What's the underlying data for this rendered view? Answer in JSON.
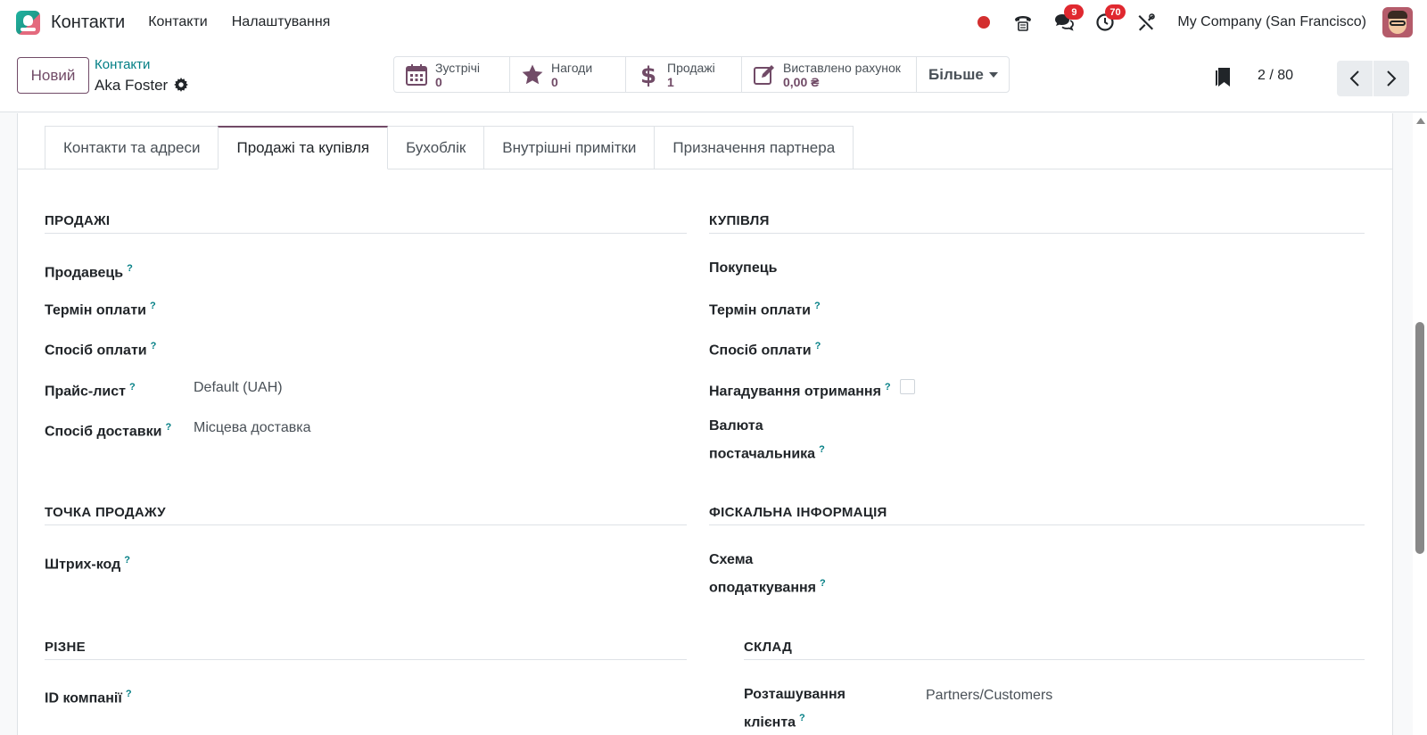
{
  "topnav": {
    "app_name": "Контакти",
    "menu": [
      "Контакти",
      "Налаштування"
    ],
    "messages_badge": "9",
    "activities_badge": "70",
    "company": "My Company (San Francisco)",
    "icons": {
      "logo": "contacts-app-icon",
      "record": "red-record-dot",
      "phone": "phone-icon",
      "messages": "chat-bubbles-icon",
      "activities": "clock-icon",
      "debug": "tools-icon"
    },
    "colors": {
      "accent": "#714b67",
      "link": "#017e84",
      "badge": "#e0282f"
    }
  },
  "control": {
    "new_button": "Новий",
    "breadcrumb": "Контакти",
    "record_name": "Aka Foster",
    "smart_buttons": [
      {
        "label": "Зустрічі",
        "value": "0",
        "icon": "calendar-icon"
      },
      {
        "label": "Нагоди",
        "value": "0",
        "icon": "star-icon"
      },
      {
        "label": "Продажі",
        "value": "1",
        "icon": "dollar-icon"
      },
      {
        "label": "Виставлено рахунок",
        "value": "0,00 ₴",
        "icon": "edit-invoice-icon"
      }
    ],
    "more_button": "Більше",
    "pager": "2 / 80"
  },
  "tabs": [
    "Контакти та адреси",
    "Продажі та купівля",
    "Бухоблік",
    "Внутрішні примітки",
    "Призначення партнера"
  ],
  "active_tab": "Продажі та купівля",
  "form": {
    "sales": {
      "title": "ПРОДАЖІ",
      "salesperson": "Продавець",
      "payment_terms": "Термін оплати",
      "payment_method": "Спосіб оплати",
      "pricelist_label": "Прайс-лист",
      "pricelist_value": "Default (UAH)",
      "delivery_label": "Спосіб доставки",
      "delivery_value": "Місцева доставка"
    },
    "purchase": {
      "title": "КУПІВЛЯ",
      "buyer": "Покупець",
      "payment_terms": "Термін оплати",
      "payment_method": "Спосіб оплати",
      "receipt_reminder": "Нагадування отримання",
      "supplier_currency_line1": "Валюта",
      "supplier_currency_line2": "постачальника"
    },
    "pos": {
      "title": "ТОЧКА ПРОДАЖУ",
      "barcode": "Штрих-код"
    },
    "fiscal": {
      "title": "ФІСКАЛЬНА ІНФОРМАЦІЯ",
      "fiscal_position_line1": "Схема",
      "fiscal_position_line2": "оподаткування"
    },
    "misc": {
      "title": "РІЗНЕ",
      "company_id": "ID компанії"
    },
    "warehouse": {
      "title": "СКЛАД",
      "customer_location_line1": "Розташування",
      "customer_location_line2": "клієнта",
      "customer_location_value": "Partners/Customers"
    },
    "help_mark": "?"
  }
}
